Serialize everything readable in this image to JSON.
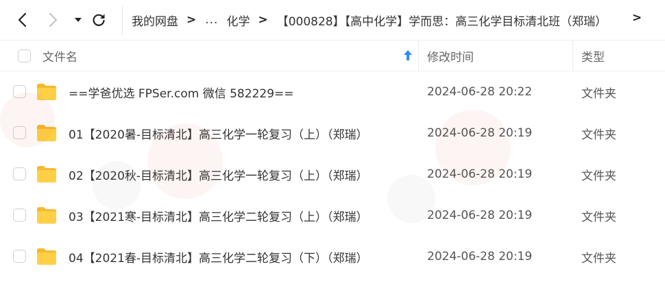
{
  "nav": {
    "back_icon": "chevron-left-icon",
    "forward_icon": "chevron-right-icon",
    "dropdown_icon": "caret-down-icon",
    "refresh_icon": "refresh-icon"
  },
  "breadcrumb": {
    "root": "我的网盘",
    "ellipsis": "...",
    "items": [
      "化学",
      "【000828】【高中化学】学而思：高三化学目标清北班（郑瑞）"
    ]
  },
  "columns": {
    "name": "文件名",
    "modified": "修改时间",
    "type": "类型"
  },
  "rows": [
    {
      "name": "==学爸优选 FPSer.com 微信 582229==",
      "modified": "2024-06-28 20:22",
      "type": "文件夹"
    },
    {
      "name": "01【2020暑-目标清北】高三化学一轮复习（上）（郑瑞）",
      "modified": "2024-06-28 20:19",
      "type": "文件夹"
    },
    {
      "name": "02【2020秋-目标清北】高三化学一轮复习（上）（郑瑞）",
      "modified": "2024-06-28 20:19",
      "type": "文件夹"
    },
    {
      "name": "03【2021寒-目标清北】高三化学二轮复习（上）（郑瑞）",
      "modified": "2024-06-28 20:19",
      "type": "文件夹"
    },
    {
      "name": "04【2021春-目标清北】高三化学二轮复习（下）（郑瑞）",
      "modified": "2024-06-28 20:19",
      "type": "文件夹"
    }
  ],
  "colors": {
    "folder": "#ffd046",
    "folder_tab": "#f5b82e",
    "accent": "#2f8cff"
  }
}
